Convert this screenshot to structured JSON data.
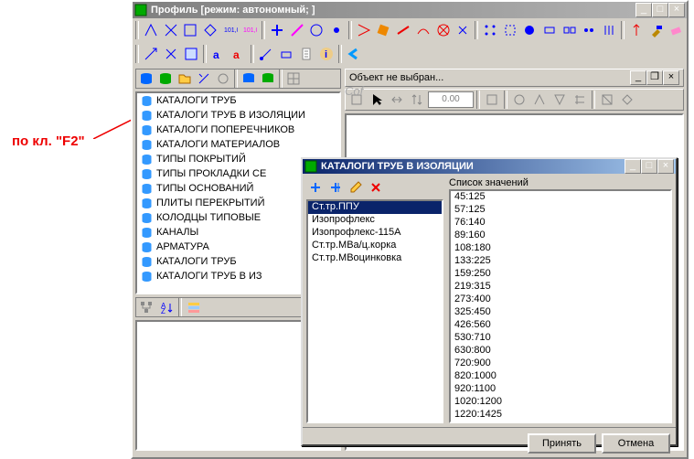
{
  "annotation": {
    "text": "по кл. \"F2\""
  },
  "main": {
    "title": "Профиль [режим: автономный; ]",
    "subtitle": "Объект не выбран...",
    "num": "0.00",
    "bg_text": "Cof"
  },
  "tree": {
    "items": [
      "КАТАЛОГИ ТРУБ",
      "КАТАЛОГИ ТРУБ В ИЗОЛЯЦИИ",
      "КАТАЛОГИ ПОПЕРЕЧНИКОВ",
      "КАТАЛОГИ МАТЕРИАЛОВ",
      "ТИПЫ ПОКРЫТИЙ",
      "ТИПЫ ПРОКЛАДКИ СЕ",
      "ТИПЫ ОСНОВАНИЙ",
      "ПЛИТЫ ПЕРЕКРЫТИЙ",
      "КОЛОДЦЫ ТИПОВЫЕ",
      "КАНАЛЫ",
      "АРМАТУРА",
      "КАТАЛОГИ ТРУБ",
      "КАТАЛОГИ ТРУБ В ИЗ"
    ]
  },
  "dialog": {
    "title": "КАТАЛОГИ ТРУБ В ИЗОЛЯЦИИ",
    "list_label": "Список значений",
    "accept": "Принять",
    "cancel": "Отмена",
    "picks": [
      "Ст.тр.ППУ",
      "Изопрофлекс",
      "Изопрофлекс-115А",
      "Ст.тр.МВа/ц.корка",
      "Ст.тр.МВоцинковка"
    ],
    "selected_pick": 0,
    "values": [
      "45:125",
      "57:125",
      "76:140",
      "89:160",
      "108:180",
      "133:225",
      "159:250",
      "219:315",
      "273:400",
      "325:450",
      "426:560",
      "530:710",
      "630:800",
      "720:900",
      "820:1000",
      "920:1100",
      "1020:1200",
      "1220:1425"
    ]
  }
}
